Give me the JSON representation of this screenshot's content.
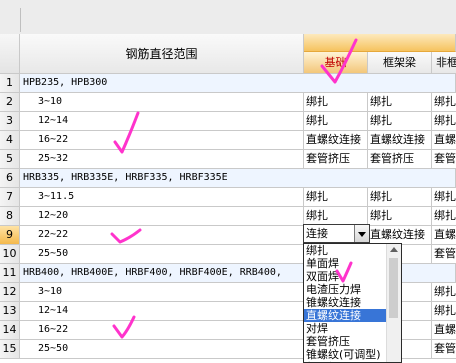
{
  "header": {
    "col_range": "钢筋直径范围",
    "col_jichu": "基础",
    "col_kuangjialiang": "框架梁",
    "col_partial": "非框"
  },
  "rows": [
    {
      "num": "1",
      "range": "HPB235, HPB300",
      "group": true,
      "c1": "",
      "c2": "",
      "c3": ""
    },
    {
      "num": "2",
      "range": "3~10",
      "group": false,
      "c1": "绑扎",
      "c2": "绑扎",
      "c3": "绑扎"
    },
    {
      "num": "3",
      "range": "12~14",
      "group": false,
      "c1": "绑扎",
      "c2": "绑扎",
      "c3": "绑扎"
    },
    {
      "num": "4",
      "range": "16~22",
      "group": false,
      "c1": "直螺纹连接",
      "c2": "直螺纹连接",
      "c3": "直螺"
    },
    {
      "num": "5",
      "range": "25~32",
      "group": false,
      "c1": "套管挤压",
      "c2": "套管挤压",
      "c3": "套管"
    },
    {
      "num": "6",
      "range": "HRB335, HRB335E, HRBF335, HRBF335E",
      "group": true,
      "c1": "",
      "c2": "",
      "c3": ""
    },
    {
      "num": "7",
      "range": "3~11.5",
      "group": false,
      "c1": "绑扎",
      "c2": "绑扎",
      "c3": "绑扎"
    },
    {
      "num": "8",
      "range": "12~20",
      "group": false,
      "c1": "绑扎",
      "c2": "绑扎",
      "c3": "绑扎"
    },
    {
      "num": "9",
      "range": "22~22",
      "group": false,
      "c1": "连接",
      "c2": "直螺纹连接",
      "c3": "直螺",
      "current": true
    },
    {
      "num": "10",
      "range": "25~50",
      "group": false,
      "c1": "",
      "c2": "压",
      "c3": "套管"
    },
    {
      "num": "11",
      "range": "HRB400, HRB400E, HRBF400, HRBF400E, RRB400,",
      "group": true,
      "c1": "",
      "c2": "",
      "c3": ""
    },
    {
      "num": "12",
      "range": "3~10",
      "group": false,
      "c1": "",
      "c2": "",
      "c3": "绑扎"
    },
    {
      "num": "13",
      "range": "12~14",
      "group": false,
      "c1": "",
      "c2": "",
      "c3": "绑扎"
    },
    {
      "num": "14",
      "range": "16~22",
      "group": false,
      "c1": "",
      "c2": "接",
      "c3": "直螺"
    },
    {
      "num": "15",
      "range": "25~50",
      "group": false,
      "c1": "",
      "c2": "压",
      "c3": "套管"
    }
  ],
  "combo": {
    "value": "连接",
    "icon": "chevron-down-icon"
  },
  "dropdown": {
    "options": [
      "绑扎",
      "单面焊",
      "双面焊",
      "电渣压力焊",
      "锥螺纹连接",
      "直螺纹连接",
      "对焊",
      "套管挤压",
      "锥螺纹(可调型)",
      "气压焊"
    ],
    "selected_index": 5
  },
  "colors": {
    "highlight_header": "#f6c35f",
    "selection": "#3875d7",
    "annotation": "#ff33cc"
  }
}
